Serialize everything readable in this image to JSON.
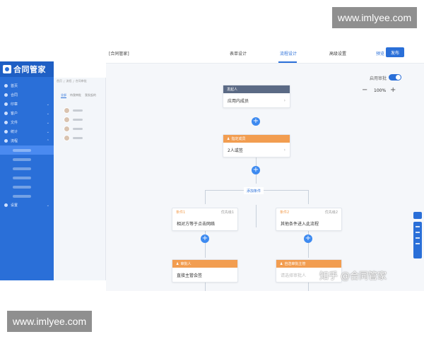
{
  "watermark": "www.imlyee.com",
  "app": {
    "logo_text": "合同管家",
    "nav": [
      {
        "label": "首页"
      },
      {
        "label": "合同"
      },
      {
        "label": "印章"
      },
      {
        "label": "客户"
      },
      {
        "label": "文件"
      },
      {
        "label": "统计"
      },
      {
        "label": "流程",
        "active": true
      },
      {
        "label": "设置"
      }
    ],
    "breadcrumb": [
      "首页",
      "流程",
      "合同审批"
    ],
    "panel_tabs": [
      "全部",
      "待我审批",
      "我发起的"
    ]
  },
  "header": {
    "title": "[合同管家]",
    "tabs": [
      "表单设计",
      "流程设计",
      "高级设置"
    ],
    "active_tab": 1,
    "preview": "预览",
    "publish": "发布"
  },
  "canvas": {
    "toggle_label": "启用审批",
    "zoom": "100%",
    "add_condition": "添加条件",
    "start_node": {
      "head": "发起人",
      "body": "应用内成员"
    },
    "approver_node": {
      "head": "指定成员",
      "body": "2人或签"
    },
    "branches": [
      {
        "cond_label": "条件1",
        "priority": "优先级1",
        "cond_body": "相对方等于点击网络",
        "approver_head": "审批人",
        "approver_body": "直接主管会签"
      },
      {
        "cond_label": "条件2",
        "priority": "优先级2",
        "cond_body": "其他条件进入此流程",
        "approver_head": "自选审批主管",
        "approver_body": "请选择审批人"
      }
    ]
  },
  "credit": "知乎 @合同管家",
  "colors": {
    "accent": "#2a6fd8",
    "orange": "#f29d50",
    "dark_head": "#5b6a85"
  }
}
